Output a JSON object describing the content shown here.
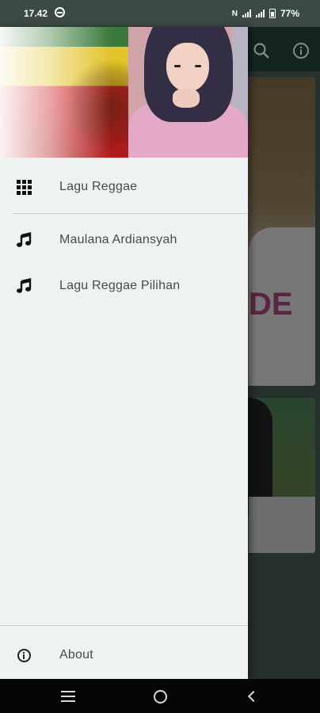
{
  "status_bar": {
    "time": "17.42",
    "network_label": "N",
    "battery": "77%"
  },
  "drawer": {
    "header_image": "reggae-artist-banner",
    "items": [
      {
        "label": "Lagu Reggae",
        "icon": "grid-icon"
      },
      {
        "label": "Maulana Ardiansyah",
        "icon": "music-note-icon"
      },
      {
        "label": "Lagu Reggae Pilihan",
        "icon": "music-note-icon"
      }
    ],
    "footer_item": {
      "label": "About",
      "icon": "info-icon"
    }
  },
  "background_toolbar": {
    "icons": [
      "search-icon",
      "info-icon"
    ]
  },
  "navigation_bar": {
    "buttons": [
      "recent-apps-icon",
      "home-icon",
      "back-icon"
    ]
  }
}
